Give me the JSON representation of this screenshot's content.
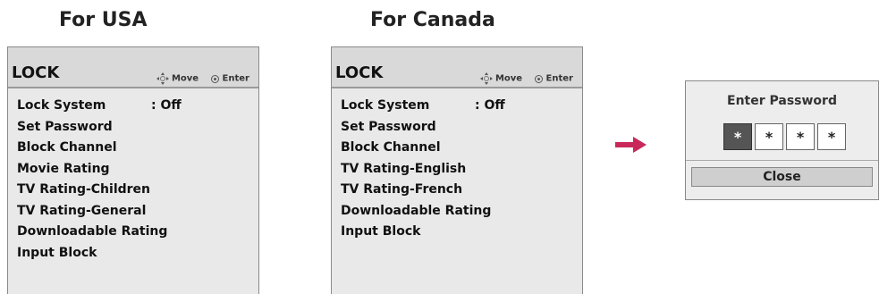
{
  "usa": {
    "heading": "For USA",
    "title": "LOCK",
    "move_label": "Move",
    "enter_label": "Enter",
    "items": [
      {
        "label": "Lock System",
        "value": ": Off"
      },
      {
        "label": "Set Password",
        "value": ""
      },
      {
        "label": "Block Channel",
        "value": ""
      },
      {
        "label": "Movie Rating",
        "value": ""
      },
      {
        "label": "TV Rating-Children",
        "value": ""
      },
      {
        "label": "TV Rating-General",
        "value": ""
      },
      {
        "label": "Downloadable Rating",
        "value": ""
      },
      {
        "label": "Input Block",
        "value": ""
      }
    ]
  },
  "canada": {
    "heading": "For Canada",
    "title": "LOCK",
    "move_label": "Move",
    "enter_label": "Enter",
    "items": [
      {
        "label": "Lock System",
        "value": ": Off"
      },
      {
        "label": "Set Password",
        "value": ""
      },
      {
        "label": "Block Channel",
        "value": ""
      },
      {
        "label": "TV Rating-English",
        "value": ""
      },
      {
        "label": "TV Rating-French",
        "value": ""
      },
      {
        "label": "Downloadable Rating",
        "value": ""
      },
      {
        "label": "Input Block",
        "value": ""
      }
    ]
  },
  "arrow_color": "#c8285a",
  "password_dialog": {
    "title": "Enter Password",
    "digits": [
      "*",
      "*",
      "*",
      "*"
    ],
    "close_label": "Close"
  }
}
